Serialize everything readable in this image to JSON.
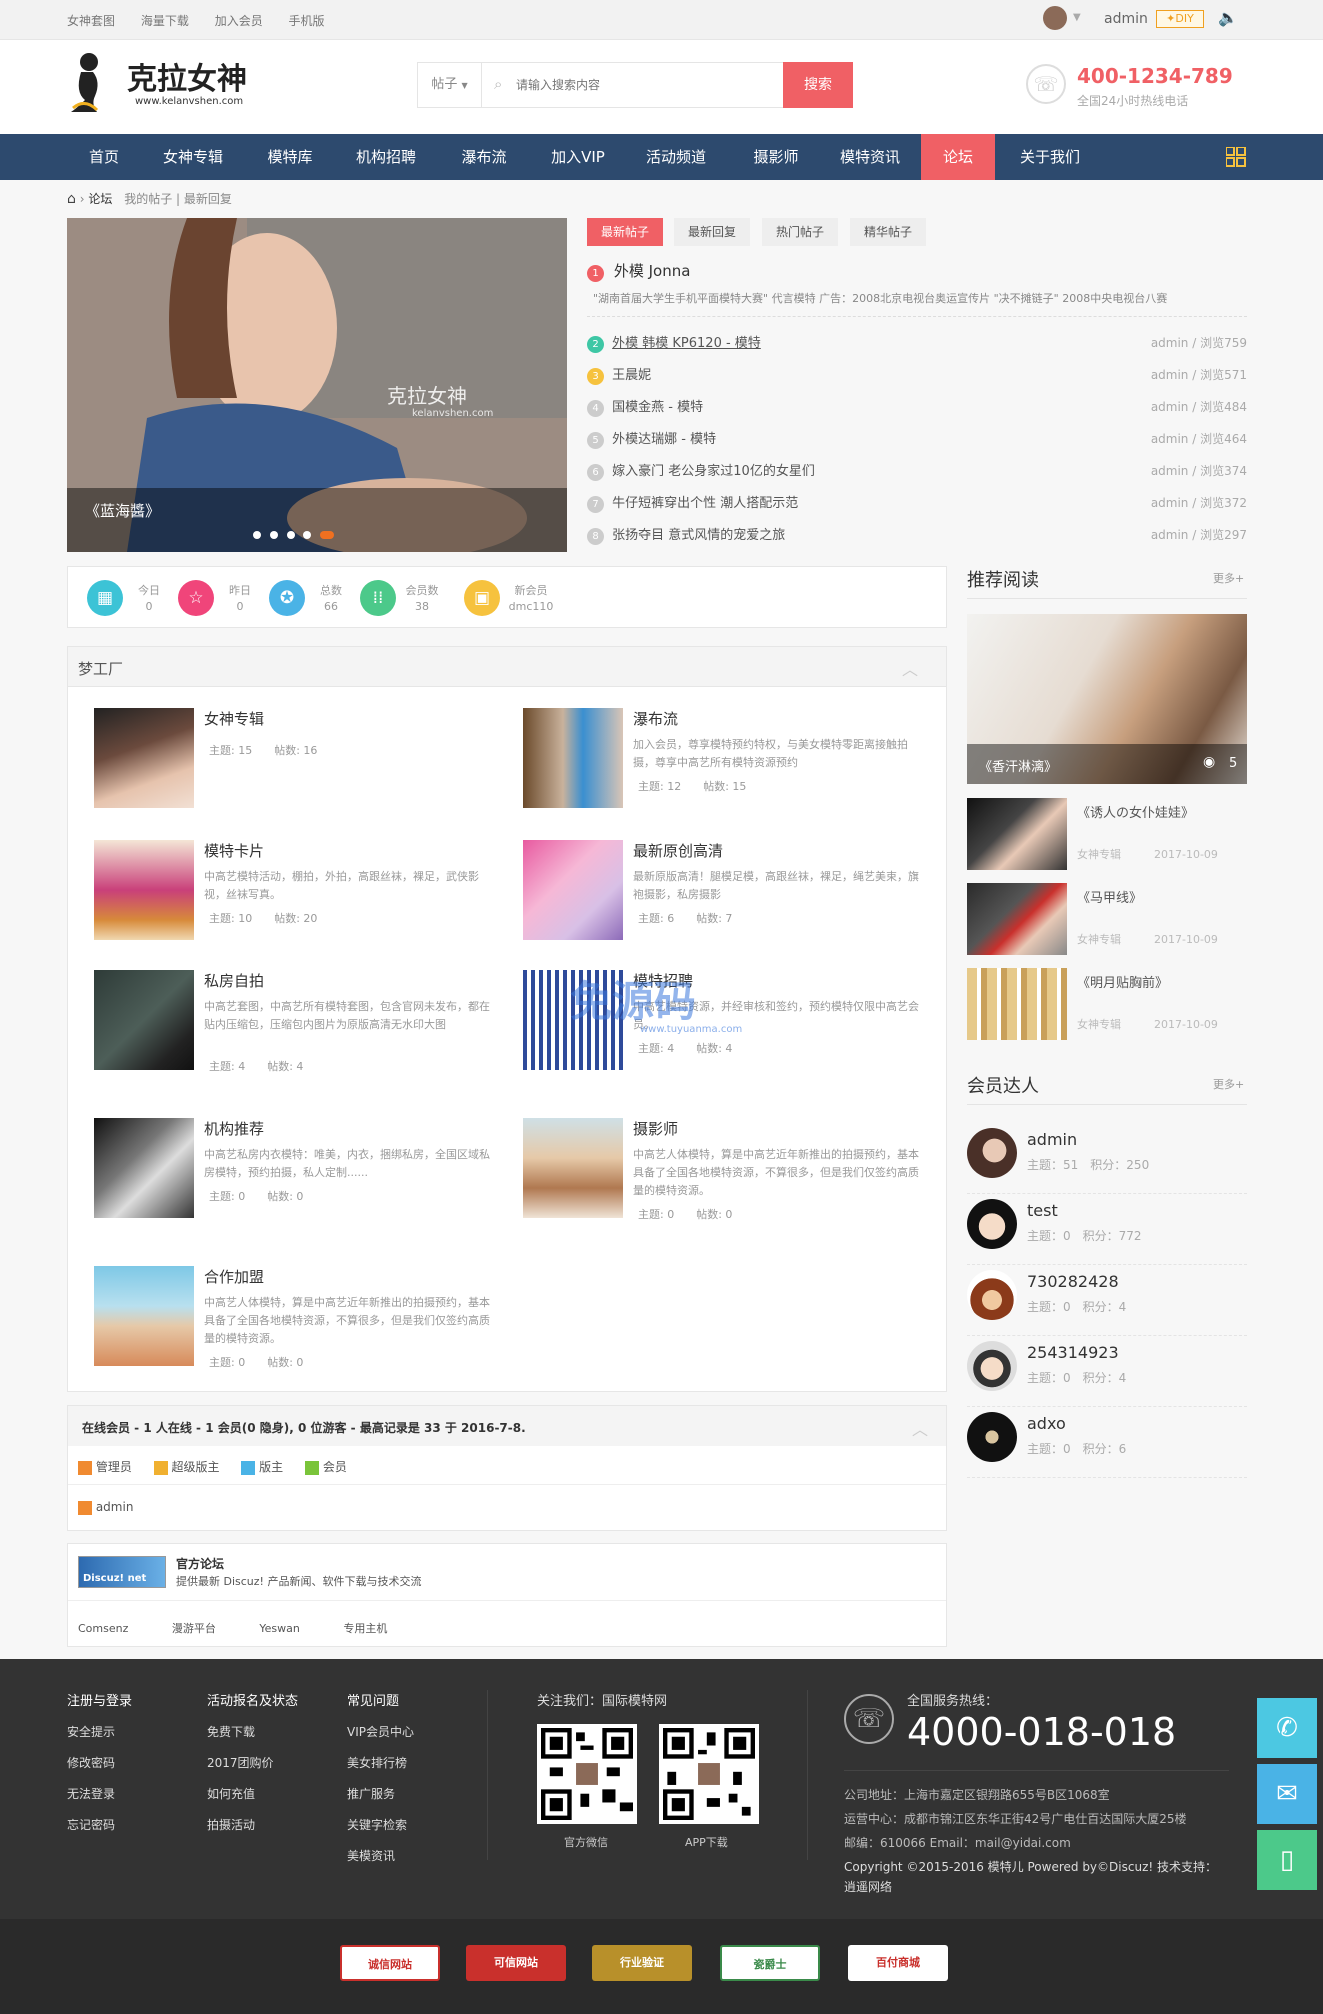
{
  "topbar": {
    "links": [
      "女神套图",
      "海量下载",
      "加入会员",
      "手机版"
    ],
    "user": "admin",
    "diy": "DIY"
  },
  "header": {
    "logo_title": "克拉女神",
    "logo_url": "www.kelanvshen.com",
    "search_type": "帖子",
    "search_placeholder": "请输入搜索内容",
    "search_button": "搜索",
    "phone": "400-1234-789",
    "phone_note": "全国24小时热线电话"
  },
  "nav": [
    "首页",
    "女神专辑",
    "模特库",
    "机构招聘",
    "瀑布流",
    "加入VIP",
    "活动频道",
    "摄影师",
    "模特资讯",
    "论坛",
    "关于我们"
  ],
  "breadcrumb": {
    "forum": "论坛",
    "links": [
      "我的帖子",
      "最新回复"
    ]
  },
  "slider": {
    "caption": "《蓝海醬》",
    "watermark": "克拉女神",
    "watermark_url": "kelanvshen.com"
  },
  "tabs": [
    "最新帖子",
    "最新回复",
    "热门帖子",
    "精华帖子"
  ],
  "top_post": {
    "num": "1",
    "title": "外模 Jonna",
    "desc": "\"湖南首届大学生手机平面模特大赛\" 代言模特 广告：2008北京电视台奥运宣传片 \"决不摊链子\"  2008中央电视台八赛"
  },
  "posts": [
    {
      "num": "2",
      "title": "外模 韩模 KP6120 - 模特",
      "meta": "admin / 浏览759"
    },
    {
      "num": "3",
      "title": "王晨妮",
      "meta": "admin / 浏览571"
    },
    {
      "num": "4",
      "title": "国模金燕 - 模特",
      "meta": "admin / 浏览484"
    },
    {
      "num": "5",
      "title": "外模达瑞娜 - 模特",
      "meta": "admin / 浏览464"
    },
    {
      "num": "6",
      "title": "嫁入豪门 老公身家过10亿的女星们",
      "meta": "admin / 浏览374"
    },
    {
      "num": "7",
      "title": "牛仔短裤穿出个性 潮人搭配示范",
      "meta": "admin / 浏览372"
    },
    {
      "num": "8",
      "title": "张扬夺目 意式风情的宠爱之旅",
      "meta": "admin / 浏览297"
    }
  ],
  "stats": [
    {
      "label": "今日",
      "value": "0",
      "color": "#3cc3d6"
    },
    {
      "label": "昨日",
      "value": "0",
      "color": "#f0457a"
    },
    {
      "label": "总数",
      "value": "66",
      "color": "#4ab3e6"
    },
    {
      "label": "会员数",
      "value": "38",
      "color": "#4cc98a"
    },
    {
      "label": "新会员",
      "value": "dmc110",
      "color": "#f6c23e"
    }
  ],
  "section": {
    "title": "梦工厂"
  },
  "forums": [
    {
      "name": "女神专辑",
      "desc": "",
      "topics": "主题: 15",
      "posts": "帖数: 16"
    },
    {
      "name": "瀑布流",
      "desc": "加入会员，尊享模特预约特权，与美女模特零距离接触拍摄，尊享中高艺所有模特资源预约",
      "topics": "主题: 12",
      "posts": "帖数: 15"
    },
    {
      "name": "模特卡片",
      "desc": "中高艺模特活动，棚拍，外拍，高跟丝袜，裸足，武侠影视，丝袜写真。",
      "topics": "主题: 10",
      "posts": "帖数: 20"
    },
    {
      "name": "最新原创高清",
      "desc": "最新原版高清！腿模足模，高跟丝袜，裸足，绳艺美束，旗袍摄影，私房摄影",
      "topics": "主题: 6",
      "posts": "帖数: 7"
    },
    {
      "name": "私房自拍",
      "desc": "中高艺套图，中高艺所有模特套图，包含官网未发布，都在贴内压缩包，压缩包内图片为原版高清无水印大图",
      "topics": "主题: 4",
      "posts": "帖数: 4"
    },
    {
      "name": "模特招聘",
      "desc": "中高艺模特资源，并经审核和签约，预约模特仅限中高艺会员。",
      "topics": "主题: 4",
      "posts": "帖数: 4"
    },
    {
      "name": "机构推荐",
      "desc": "中高艺私房内衣模特：唯美，内衣，捆绑私房，全国区域私房模特，预约拍摄，私人定制......",
      "topics": "主题: 0",
      "posts": "帖数: 0"
    },
    {
      "name": "摄影师",
      "desc": "中高艺人体模特，算是中高艺近年新推出的拍摄预约，基本具备了全国各地模特资源，不算很多，但是我们仅签约高质量的模特资源。",
      "topics": "主题: 0",
      "posts": "帖数: 0"
    },
    {
      "name": "合作加盟",
      "desc": "中高艺人体模特，算是中高艺近年新推出的拍摄预约，基本具备了全国各地模特资源，不算很多，但是我们仅签约高质量的模特资源。",
      "topics": "主题: 0",
      "posts": "帖数: 0"
    }
  ],
  "online": {
    "text": "在线会员 - 1 人在线 - 1 会员(0 隐身), 0 位游客 - 最高记录是 33 于 2016-7-8.",
    "roles": [
      "管理员",
      "超级版主",
      "版主",
      "会员"
    ],
    "user": "admin"
  },
  "links_box": {
    "logo": "Discuz! net",
    "title": "官方论坛",
    "desc": "提供最新 Discuz! 产品新闻、软件下载与技术交流",
    "links": [
      "Comsenz",
      "漫游平台",
      "Yeswan",
      "专用主机"
    ]
  },
  "recommend": {
    "title": "推荐阅读",
    "more": "更多+",
    "hero_caption": "《香汗淋漓》",
    "views": "5",
    "items": [
      {
        "title": "《诱人の女仆娃娃》",
        "cat": "女神专辑",
        "date": "2017-10-09"
      },
      {
        "title": "《马甲线》",
        "cat": "女神专辑",
        "date": "2017-10-09"
      },
      {
        "title": "《明月贴胸前》",
        "cat": "女神专辑",
        "date": "2017-10-09"
      }
    ]
  },
  "members": {
    "title": "会员达人",
    "more": "更多+",
    "items": [
      {
        "name": "admin",
        "topics": "主题：51",
        "points": "积分：250"
      },
      {
        "name": "test",
        "topics": "主题：0",
        "points": "积分：772"
      },
      {
        "name": "730282428",
        "topics": "主题：0",
        "points": "积分：4"
      },
      {
        "name": "254314923",
        "topics": "主题：0",
        "points": "积分：4"
      },
      {
        "name": "adxo",
        "topics": "主题：0",
        "points": "积分：6"
      }
    ]
  },
  "footer": {
    "cols": [
      {
        "title": "注册与登录",
        "items": [
          "安全提示",
          "修改密码",
          "无法登录",
          "忘记密码"
        ]
      },
      {
        "title": "活动报名及状态",
        "items": [
          "免费下载",
          "2017团购价",
          "如何充值",
          "拍摄活动"
        ]
      },
      {
        "title": "常见问题",
        "items": [
          "VIP会员中心",
          "美女排行榜",
          "推广服务",
          "关键字检索",
          "美模资讯"
        ]
      }
    ],
    "follow": "关注我们：国际模特网",
    "qr_labels": [
      "官方微信",
      "APP下载"
    ],
    "hotline_label": "全国服务热线：",
    "hotline": "4000-018-018",
    "addr": "公司地址：上海市嘉定区银翔路655号B区1068室",
    "ops": "运营中心：成都市锦江区东华正街42号广电仕百达国际大厦25楼",
    "mail": "邮编：610066 Email：mail@yidai.com",
    "copy": "Copyright   ©2015-2016  模特儿  Powered by©Discuz!  技术支持：",
    "copy2": "逍遥网络",
    "badges": [
      "诚信网站",
      "可信网站",
      "行业验证",
      "瓷爵士",
      "百付商城"
    ]
  },
  "watermark": {
    "text": "免源码",
    "url": "www.tuyuanma.com"
  }
}
